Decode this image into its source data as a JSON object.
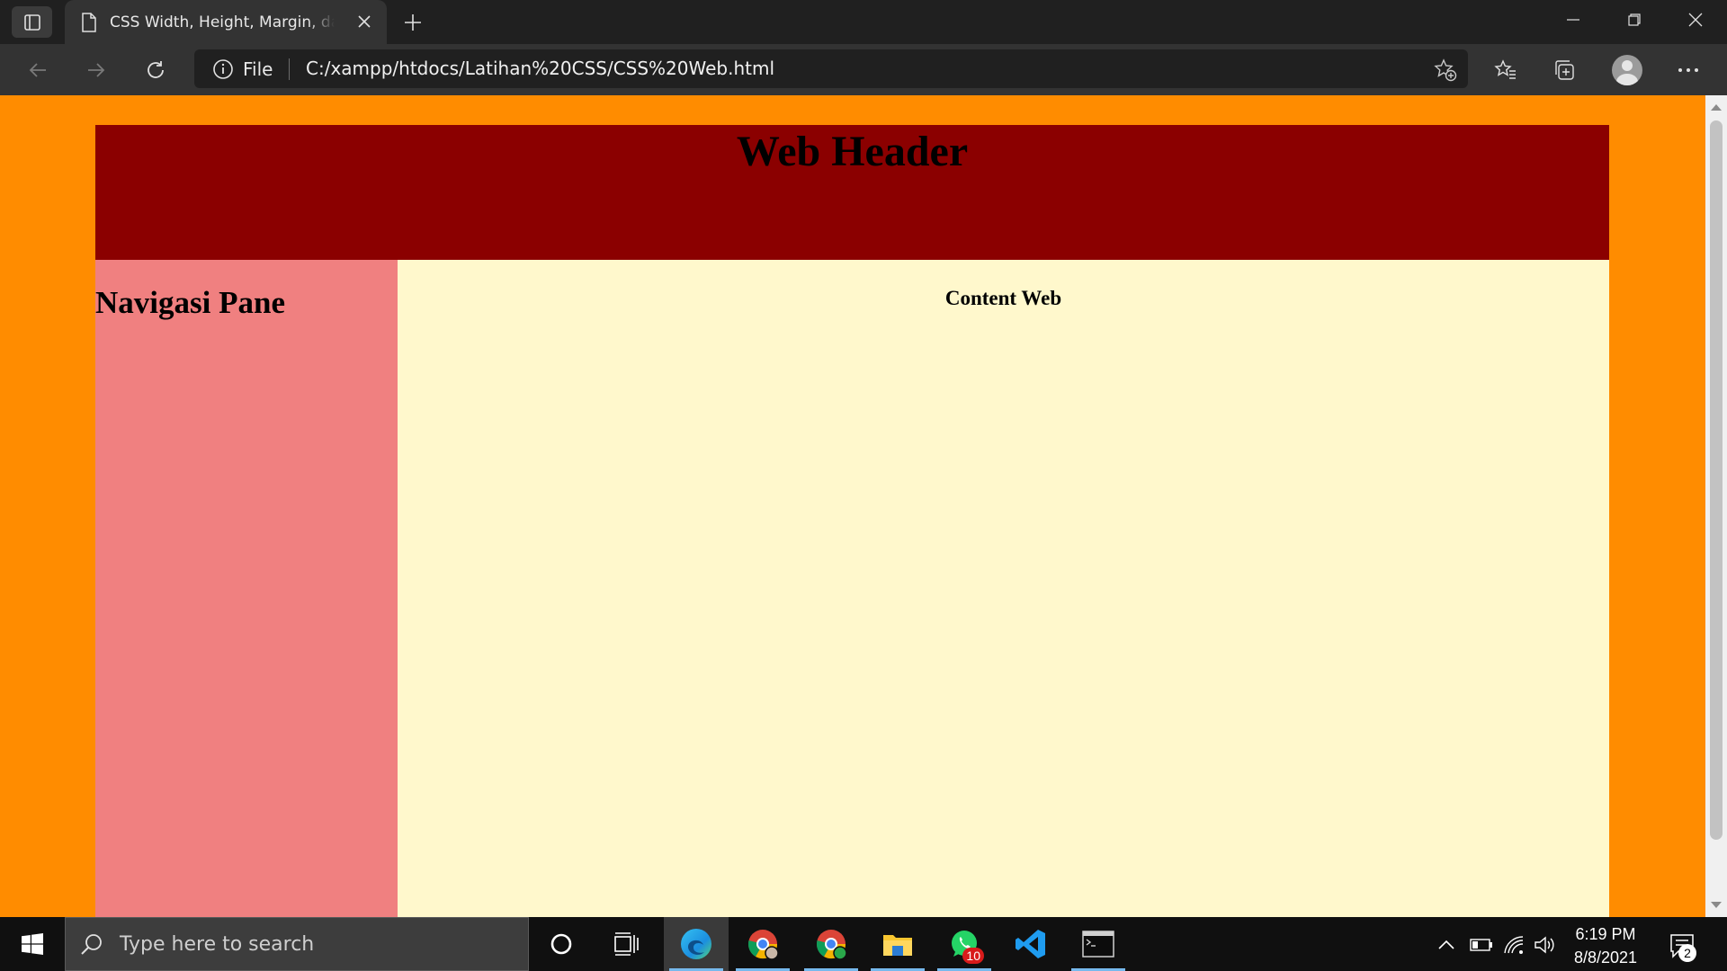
{
  "browser": {
    "tab": {
      "title": "CSS Width, Height, Margin, dan Padding",
      "icon": "page-icon"
    },
    "address": {
      "scheme_label": "File",
      "url": "C:/xampp/htdocs/Latihan%20CSS/CSS%20Web.html"
    }
  },
  "page": {
    "header_title": "Web Header",
    "nav_title": "Navigasi Pane",
    "content_title": "Content Web",
    "colors": {
      "background": "#ff8c00",
      "header": "#8b0000",
      "nav": "#f08080",
      "content": "#fff8cc"
    }
  },
  "taskbar": {
    "search_placeholder": "Type here to search",
    "whatsapp_badge": "10",
    "clock_time": "6:19 PM",
    "clock_date": "8/8/2021",
    "notification_count": "2",
    "apps": [
      "cortana",
      "task-view",
      "edge",
      "chrome-profile",
      "chrome-dev",
      "file-explorer",
      "whatsapp",
      "vscode",
      "terminal"
    ]
  }
}
